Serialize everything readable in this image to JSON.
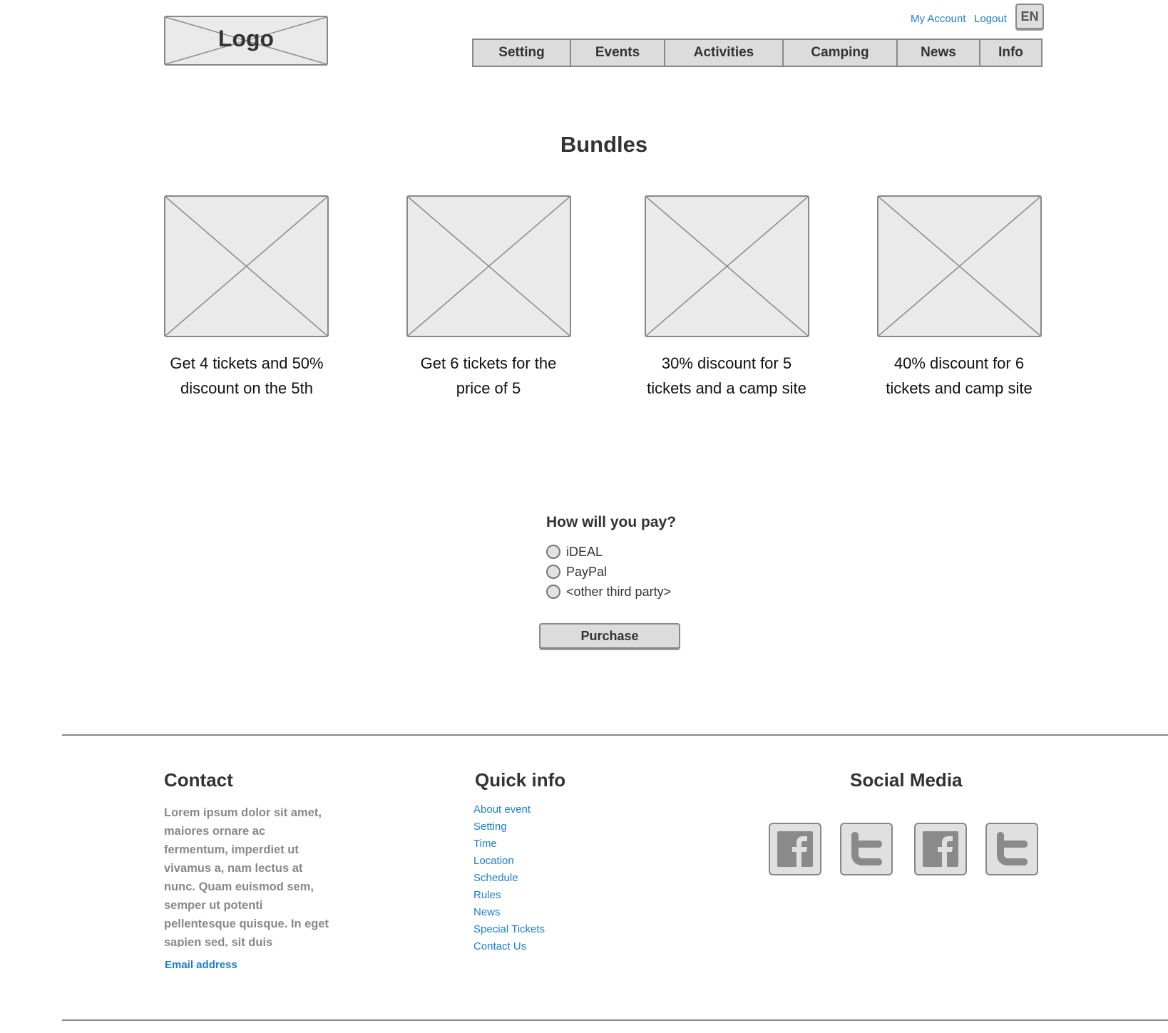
{
  "header": {
    "logo_text": "Logo",
    "links": {
      "my_account": "My Account",
      "logout": "Logout"
    },
    "language": "EN",
    "nav": [
      "Setting",
      "Events",
      "Activities",
      "Camping",
      "News",
      "Info"
    ]
  },
  "main": {
    "title": "Bundles",
    "bundles": [
      {
        "caption": "Get 4 tickets and 50% discount on the 5th"
      },
      {
        "caption": "Get 6 tickets for the price of 5"
      },
      {
        "caption": "30% discount for 5 tickets and a camp site"
      },
      {
        "caption": "40% discount for 6 tickets and camp site"
      }
    ],
    "payment": {
      "question": "How will you pay?",
      "options": [
        "iDEAL",
        "PayPal",
        "<other third party>"
      ],
      "purchase_label": "Purchase"
    }
  },
  "footer": {
    "contact": {
      "heading": "Contact",
      "text": "Lorem ipsum dolor sit amet, maiores ornare ac fermentum, imperdiet ut vivamus a, nam lectus at nunc. Quam euismod sem, semper ut potenti pellentesque quisque. In eget sapien sed, sit duis vestibulum ultricies, placerat morbi amet",
      "email_label": "Email address"
    },
    "quick_info": {
      "heading": "Quick info",
      "links": [
        "About event",
        "Setting",
        "Time",
        "Location",
        "Schedule",
        "Rules",
        "News",
        "Special Tickets",
        "Contact Us"
      ]
    },
    "social": {
      "heading": "Social Media",
      "icons": [
        "facebook-icon",
        "twitter-icon",
        "facebook-icon",
        "twitter-icon"
      ]
    }
  },
  "colors": {
    "link": "#1a7fd4",
    "placeholder_fill": "#eaeaea",
    "border": "#888888",
    "text": "#333333"
  }
}
